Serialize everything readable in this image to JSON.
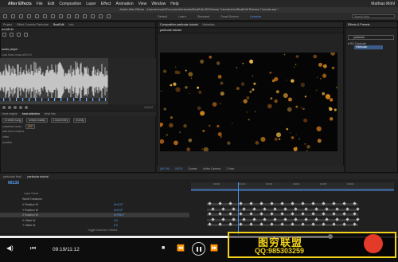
{
  "menubar": {
    "app": "After Effects",
    "items": [
      "File",
      "Edit",
      "Composition",
      "Layer",
      "Effect",
      "Animation",
      "View",
      "Window",
      "Help"
    ],
    "user": "Mathias Möhl"
  },
  "titlebar": "Adobe After Effects - /Users/mmoehl/Documents/tutorials/BeatEdit AE/Release Tutorial/ache/BeatEdit Release Tutorials.aep *",
  "workspaces": [
    "Default",
    "Learn",
    "Standard",
    "Small Screen",
    "Libraries"
  ],
  "workspace_active": "Libraries",
  "search_help": "Search Help",
  "left_panel": {
    "tabs": [
      "Project",
      "Effect Controls Particular",
      "BeatEdit",
      "Info"
    ],
    "title": "beatEdit",
    "audio_label": "audio player",
    "layer_info": "Load Music   music.aiff 0:00",
    "wave_time": "0:00:12",
    "subtabs": [
      "beat engine",
      "beat selection",
      "beat info"
    ],
    "subtab_active": "beat selection",
    "rows": [
      {
        "label": "in entire song",
        "dd": "select exactly",
        "dd2": "1 beat every",
        "opt": "evenly"
      },
      {
        "label": "substitute beats:",
        "dd": "OFF"
      },
      {
        "label": "add extra markers",
        "dd": ""
      },
      {
        "label": "offset",
        "dd": "",
        "val": ""
      },
      {
        "label": "duration",
        "dd": "",
        "val": ""
      }
    ]
  },
  "comp_panel": {
    "tabs": [
      "Composition particular tutorial",
      "Metadata"
    ],
    "subtab": "particular tutorial",
    "viewer_bar": [
      "(46.7%)",
      "00133",
      "Quarter",
      "Active Camera",
      "1 View"
    ]
  },
  "fx_panel": {
    "tabs": [
      "Effects & Presets"
    ],
    "search_value": "particular",
    "tree": "▾ RG Trapcode",
    "item": "Particular"
  },
  "timeline": {
    "tabs": [
      "particular final",
      "particular tutorial"
    ],
    "active_tab": "particular tutorial",
    "timecode": "00133",
    "ruler_labels": [
      "00050",
      "00100",
      "00150",
      "00200",
      "00250",
      "00300"
    ],
    "layer_header": "Layer Name",
    "layers": [
      {
        "name": "World Transform",
        "value": ""
      },
      {
        "name": "X Rotation W",
        "value": "0x+0.0°"
      },
      {
        "name": "Y Rotation W",
        "value": "0x+0.0°"
      },
      {
        "name": "Z Rotation W",
        "value": "0x+95.0°"
      },
      {
        "name": "X Offset W",
        "value": "0.0"
      },
      {
        "name": "Y Offset W",
        "value": "0.0"
      }
    ],
    "toggle_label": "Toggle Switches / Modes"
  },
  "player": {
    "time": "09:19/11:12",
    "progress": 0.83
  },
  "watermark": {
    "title": "图穷联盟",
    "qq": "QQ:985303259"
  }
}
